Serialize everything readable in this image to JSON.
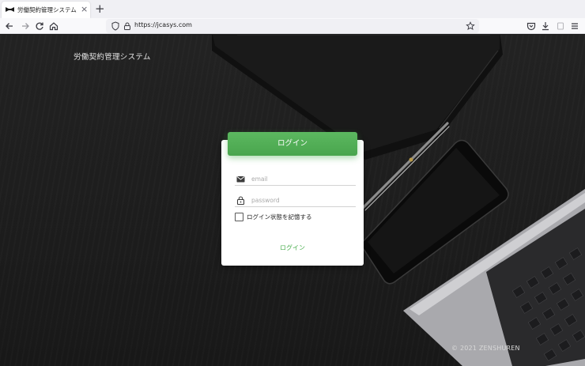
{
  "browser": {
    "tab": {
      "title": "労働契約管理システム",
      "close": "×"
    },
    "new_tab": "+",
    "url": "https://jcasys.com",
    "icons": [
      "back-icon",
      "forward-icon",
      "reload-icon",
      "home-icon",
      "shield-icon",
      "lock-icon",
      "bookmark-star-icon",
      "pocket-icon",
      "download-icon",
      "extensions-icon",
      "menu-icon"
    ]
  },
  "page": {
    "app_title": "労働契約管理システム",
    "login_card": {
      "header": "ログイン",
      "email": {
        "placeholder": "email",
        "value": ""
      },
      "password": {
        "placeholder": "password",
        "value": ""
      },
      "remember_label": "ログイン状態を記憶する",
      "remember_checked": false,
      "submit_label": "ログイン"
    },
    "footer": "© 2021 ZENSHUREN"
  },
  "colors": {
    "accent": "#4caf50",
    "background": "#1c1c1c"
  }
}
